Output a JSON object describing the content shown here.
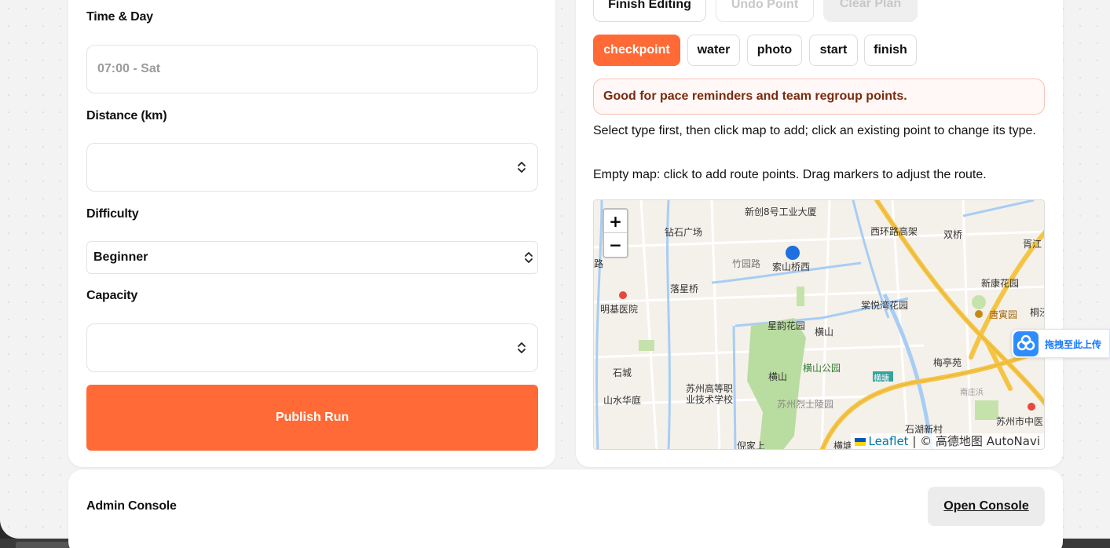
{
  "form": {
    "time_label": "Time & Day",
    "time_placeholder": "07:00 - Sat",
    "distance_label": "Distance (km)",
    "distance_value": "",
    "difficulty_label": "Difficulty",
    "difficulty_value": "Beginner",
    "capacity_label": "Capacity",
    "capacity_value": "",
    "publish_label": "Publish Run"
  },
  "route_editor": {
    "finish_editing_label": "Finish Editing",
    "undo_point_label": "Undo Point",
    "clear_plan_label": "Clear Plan",
    "point_types": [
      {
        "label": "checkpoint",
        "active": true
      },
      {
        "label": "water",
        "active": false
      },
      {
        "label": "photo",
        "active": false
      },
      {
        "label": "start",
        "active": false
      },
      {
        "label": "finish",
        "active": false
      }
    ],
    "hint": "Good for pace reminders and team regroup points.",
    "instruction": "Select type first, then click map to add; click an existing point to change its type.",
    "empty_map_note": "Empty map: click to add route points. Drag markers to adjust the route."
  },
  "map": {
    "zoom_in": "+",
    "zoom_out": "−",
    "attribution_link": "Leaflet",
    "attribution_text": "| © 高德地图 AutoNavi",
    "labels": {
      "l1": "新创8号工业大厦",
      "l2": "钻石广场",
      "l3": "西环路高架",
      "l4": "双桥",
      "l5": "胥江",
      "l6": "竹园路",
      "l7": "索山桥西",
      "l8": "落星桥",
      "l9": "新康花园",
      "l10": "明基医院",
      "l11": "棠悦湾花园",
      "l12": "唐寅园",
      "l13": "桐泾",
      "l14": "星韵花园",
      "l15": "横山",
      "l16": "石城",
      "l17": "横山公园",
      "l18": "梅亭苑",
      "l19": "苏州高等职",
      "l20": "业技术学校",
      "l21": "横山",
      "l22": "横塘",
      "l23": "山水华庭",
      "l24": "苏州烈士陵园",
      "l25": "南庄浜",
      "l26": "苏州市中医",
      "l27": "石湖新村",
      "l28": "横塘",
      "l29": "倪家上",
      "l30": "路"
    }
  },
  "upload_widget": {
    "label": "拖拽至此上传"
  },
  "admin": {
    "title": "Admin Console",
    "open_label": "Open Console"
  },
  "colors": {
    "accent": "#ff6a36",
    "hint_text": "#7a2a0e",
    "upload_blue": "#1677ff"
  }
}
